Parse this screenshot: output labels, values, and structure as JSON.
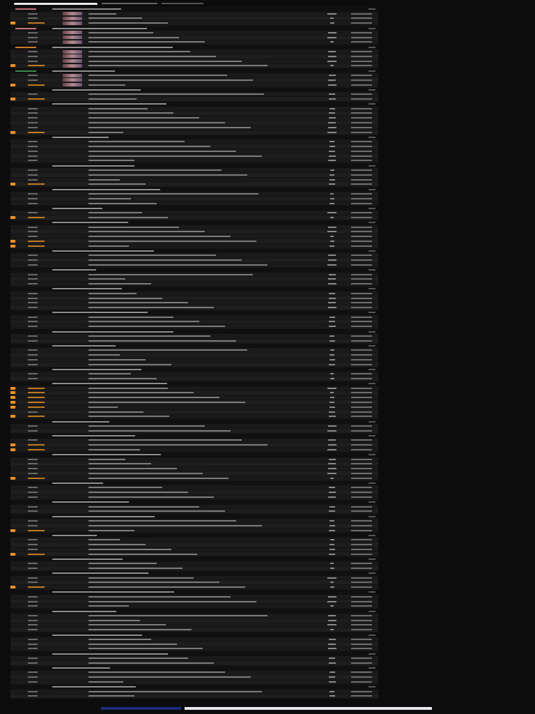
{
  "groups": [
    {
      "color": "#c8707e",
      "thumbnails": true,
      "rows": [
        {
          "flagged": false
        },
        {
          "flagged": false
        },
        {
          "flagged": true
        }
      ]
    },
    {
      "color": "#c8707e",
      "thumbnails": true,
      "rows": [
        {
          "flagged": false
        },
        {
          "flagged": false
        },
        {
          "flagged": false
        }
      ]
    },
    {
      "color": "#d0782c",
      "thumbnails": true,
      "rows": [
        {
          "flagged": false
        },
        {
          "flagged": false
        },
        {
          "flagged": false
        },
        {
          "flagged": true
        }
      ]
    },
    {
      "color": "#3a8a4a",
      "thumbnails": true,
      "rows": [
        {
          "flagged": false
        },
        {
          "flagged": false
        },
        {
          "flagged": true
        }
      ]
    },
    {
      "rows": [
        {
          "flagged": false
        },
        {
          "flagged": true
        }
      ]
    },
    {
      "rows": [
        {
          "flagged": false
        },
        {
          "flagged": false
        },
        {
          "flagged": false
        },
        {
          "flagged": false
        },
        {
          "flagged": false
        },
        {
          "flagged": true
        }
      ]
    },
    {
      "rows": [
        {
          "flagged": false
        },
        {
          "flagged": false
        },
        {
          "flagged": false
        },
        {
          "flagged": false
        },
        {
          "flagged": false
        }
      ]
    },
    {
      "rows": [
        {
          "flagged": false
        },
        {
          "flagged": false
        },
        {
          "flagged": false
        },
        {
          "flagged": true
        }
      ]
    },
    {
      "rows": [
        {
          "flagged": false
        },
        {
          "flagged": false
        },
        {
          "flagged": false
        }
      ]
    },
    {
      "rows": [
        {
          "flagged": false
        },
        {
          "flagged": true
        }
      ]
    },
    {
      "rows": [
        {
          "flagged": false
        },
        {
          "flagged": false
        },
        {
          "flagged": false
        },
        {
          "flagged": true
        },
        {
          "flagged": true
        }
      ]
    },
    {
      "rows": [
        {
          "flagged": false
        },
        {
          "flagged": false
        },
        {
          "flagged": false
        }
      ]
    },
    {
      "rows": [
        {
          "flagged": false
        },
        {
          "flagged": false
        },
        {
          "flagged": false
        }
      ]
    },
    {
      "rows": [
        {
          "flagged": false
        },
        {
          "flagged": false
        },
        {
          "flagged": false
        },
        {
          "flagged": false
        }
      ]
    },
    {
      "rows": [
        {
          "flagged": false
        },
        {
          "flagged": false
        },
        {
          "flagged": false
        }
      ]
    },
    {
      "rows": [
        {
          "flagged": false
        },
        {
          "flagged": false
        }
      ]
    },
    {
      "rows": [
        {
          "flagged": false
        },
        {
          "flagged": false
        },
        {
          "flagged": false
        },
        {
          "flagged": false
        }
      ]
    },
    {
      "rows": [
        {
          "flagged": false
        },
        {
          "flagged": false
        }
      ]
    },
    {
      "rows": [
        {
          "flagged": true
        },
        {
          "flagged": true
        },
        {
          "flagged": true
        },
        {
          "flagged": true
        },
        {
          "flagged": true
        },
        {
          "flagged": false
        },
        {
          "flagged": true
        }
      ]
    },
    {
      "rows": [
        {
          "flagged": false
        },
        {
          "flagged": false
        }
      ]
    },
    {
      "rows": [
        {
          "flagged": false
        },
        {
          "flagged": true
        },
        {
          "flagged": true
        }
      ]
    },
    {
      "rows": [
        {
          "flagged": false
        },
        {
          "flagged": false
        },
        {
          "flagged": false
        },
        {
          "flagged": false
        },
        {
          "flagged": true
        }
      ]
    },
    {
      "rows": [
        {
          "flagged": false
        },
        {
          "flagged": false
        },
        {
          "flagged": false
        }
      ]
    },
    {
      "rows": [
        {
          "flagged": false
        },
        {
          "flagged": false
        }
      ]
    },
    {
      "rows": [
        {
          "flagged": false
        },
        {
          "flagged": false
        },
        {
          "flagged": true
        }
      ]
    },
    {
      "rows": [
        {
          "flagged": false
        },
        {
          "flagged": false
        },
        {
          "flagged": false
        },
        {
          "flagged": true
        }
      ]
    },
    {
      "rows": [
        {
          "flagged": false
        },
        {
          "flagged": false
        }
      ]
    },
    {
      "rows": [
        {
          "flagged": false
        },
        {
          "flagged": false
        },
        {
          "flagged": true
        }
      ]
    },
    {
      "rows": [
        {
          "flagged": false
        },
        {
          "flagged": false
        },
        {
          "flagged": false
        }
      ]
    },
    {
      "rows": [
        {
          "flagged": false
        },
        {
          "flagged": false
        },
        {
          "flagged": false
        },
        {
          "flagged": false
        }
      ]
    },
    {
      "rows": [
        {
          "flagged": false
        },
        {
          "flagged": false
        },
        {
          "flagged": false
        }
      ]
    },
    {
      "rows": [
        {
          "flagged": false
        },
        {
          "flagged": false
        }
      ]
    },
    {
      "rows": [
        {
          "flagged": false
        },
        {
          "flagged": false
        },
        {
          "flagged": false
        }
      ]
    },
    {
      "rows": [
        {
          "flagged": false
        },
        {
          "flagged": false
        }
      ]
    }
  ]
}
